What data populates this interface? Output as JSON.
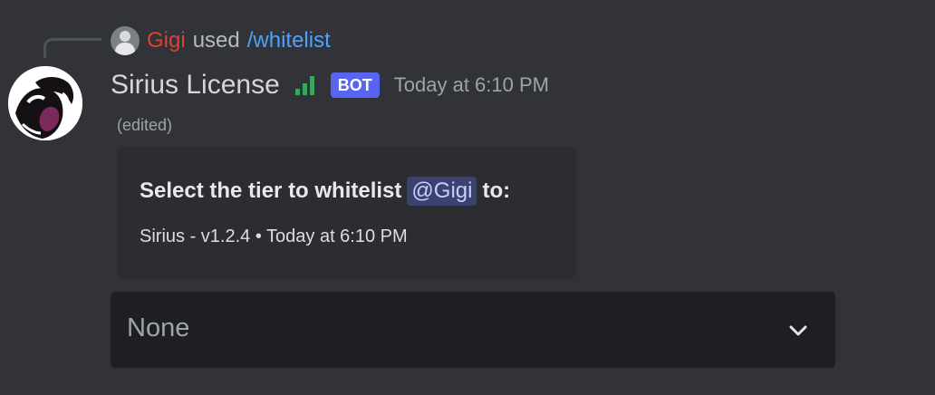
{
  "reply": {
    "user": "Gigi",
    "used": "used",
    "command": "/whitelist"
  },
  "message": {
    "author": "Sirius License",
    "bot_tag": "BOT",
    "timestamp": "Today at 6:10 PM",
    "edited": "(edited)"
  },
  "embed": {
    "title_prefix": "Select the tier to whitelist",
    "mention": "@Gigi",
    "title_suffix": "to:",
    "footer": "Sirius - v1.2.4 • Today at 6:10 PM"
  },
  "select_menu": {
    "value": "None"
  },
  "icons": {
    "reply_avatar": "user-avatar-icon",
    "bot_avatar": "bot-avatar-icon",
    "signal": "signal-bars-icon",
    "chevron": "chevron-down-icon"
  },
  "colors": {
    "background": "#313338",
    "username_red": "#d9432f",
    "command_link": "#4aa3ff",
    "bot_tag": "#5865f2",
    "signal_green": "#3ba55d",
    "embed_bg": "#2b2d31",
    "select_bg": "#1e1f22"
  }
}
